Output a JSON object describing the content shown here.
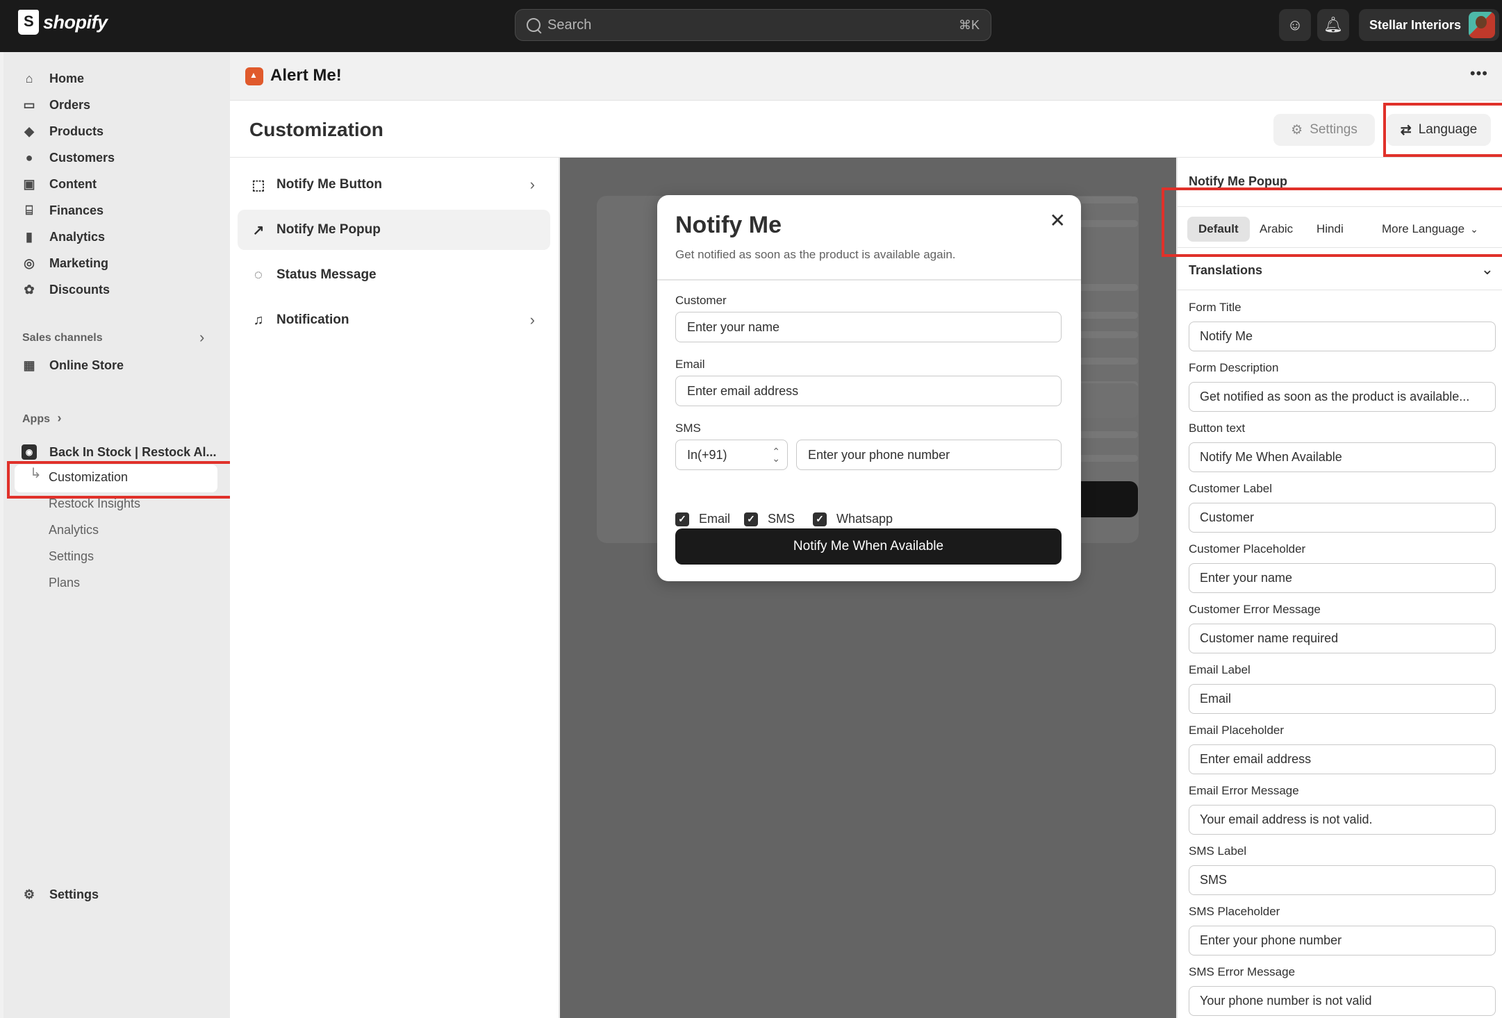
{
  "topbar": {
    "logo_text": "shopify",
    "search_placeholder": "Search",
    "search_shortcut": "⌘K",
    "store_name": "Stellar Interiors"
  },
  "nav": {
    "items": [
      {
        "label": "Home",
        "icon": "home-icon"
      },
      {
        "label": "Orders",
        "icon": "inbox-icon"
      },
      {
        "label": "Products",
        "icon": "tag-icon"
      },
      {
        "label": "Customers",
        "icon": "person-icon"
      },
      {
        "label": "Content",
        "icon": "monitor-icon"
      },
      {
        "label": "Finances",
        "icon": "bank-icon"
      },
      {
        "label": "Analytics",
        "icon": "bar-chart-icon"
      },
      {
        "label": "Marketing",
        "icon": "target-icon"
      },
      {
        "label": "Discounts",
        "icon": "discount-icon"
      }
    ],
    "sales_channels_label": "Sales channels",
    "online_store": "Online Store",
    "apps_label": "Apps",
    "app_name": "Back In Stock | Restock Al...",
    "app_sub": [
      "Customization",
      "Restock Insights",
      "Analytics",
      "Settings",
      "Plans"
    ],
    "settings": "Settings"
  },
  "appbar": {
    "title": "Alert Me!",
    "more": "•••"
  },
  "page": {
    "title": "Customization",
    "settings_btn": "Settings",
    "language_btn": "Language"
  },
  "menu": {
    "items": [
      {
        "label": "Notify Me Button",
        "chevron": "›"
      },
      {
        "label": "Notify Me Popup",
        "chevron": ""
      },
      {
        "label": "Status Message",
        "chevron": ""
      },
      {
        "label": "Notification",
        "chevron": "›"
      }
    ]
  },
  "modal": {
    "title": "Notify Me",
    "description": "Get notified as soon as the product is available again.",
    "close": "✕",
    "customer_label": "Customer",
    "customer_placeholder": "Enter your name",
    "email_label": "Email",
    "email_placeholder": "Enter email address",
    "sms_label": "SMS",
    "country_code": "In(+91)",
    "phone_placeholder": "Enter your phone number",
    "checkboxes": [
      "Email",
      "SMS",
      "Whatsapp"
    ],
    "submit": "Notify Me When Available"
  },
  "panel": {
    "title": "Notify Me Popup",
    "tabs": [
      "Default",
      "Arabic",
      "Hindi",
      "More Language"
    ],
    "translations_label": "Translations",
    "fields": [
      {
        "label": "Form Title",
        "value": "Notify Me"
      },
      {
        "label": "Form Description",
        "value": "Get notified as soon as the product is available..."
      },
      {
        "label": "Button text",
        "value": "Notify Me When Available"
      },
      {
        "label": "Customer Label",
        "value": "Customer"
      },
      {
        "label": "Customer Placeholder",
        "value": "Enter your name"
      },
      {
        "label": "Customer Error Message",
        "value": "Customer name required"
      },
      {
        "label": "Email Label",
        "value": "Email"
      },
      {
        "label": "Email Placeholder",
        "value": "Enter email address"
      },
      {
        "label": "Email Error Message",
        "value": "Your email address is not valid."
      },
      {
        "label": "SMS Label",
        "value": "SMS"
      },
      {
        "label": "SMS Placeholder",
        "value": "Enter your phone number"
      },
      {
        "label": "SMS Error Message",
        "value": "Your phone number is not valid"
      }
    ]
  },
  "colors": {
    "topbar": "#1a1a1a",
    "highlight": "#e0312a",
    "preview_bg": "#646464",
    "app_icon": "#e05a2c"
  }
}
